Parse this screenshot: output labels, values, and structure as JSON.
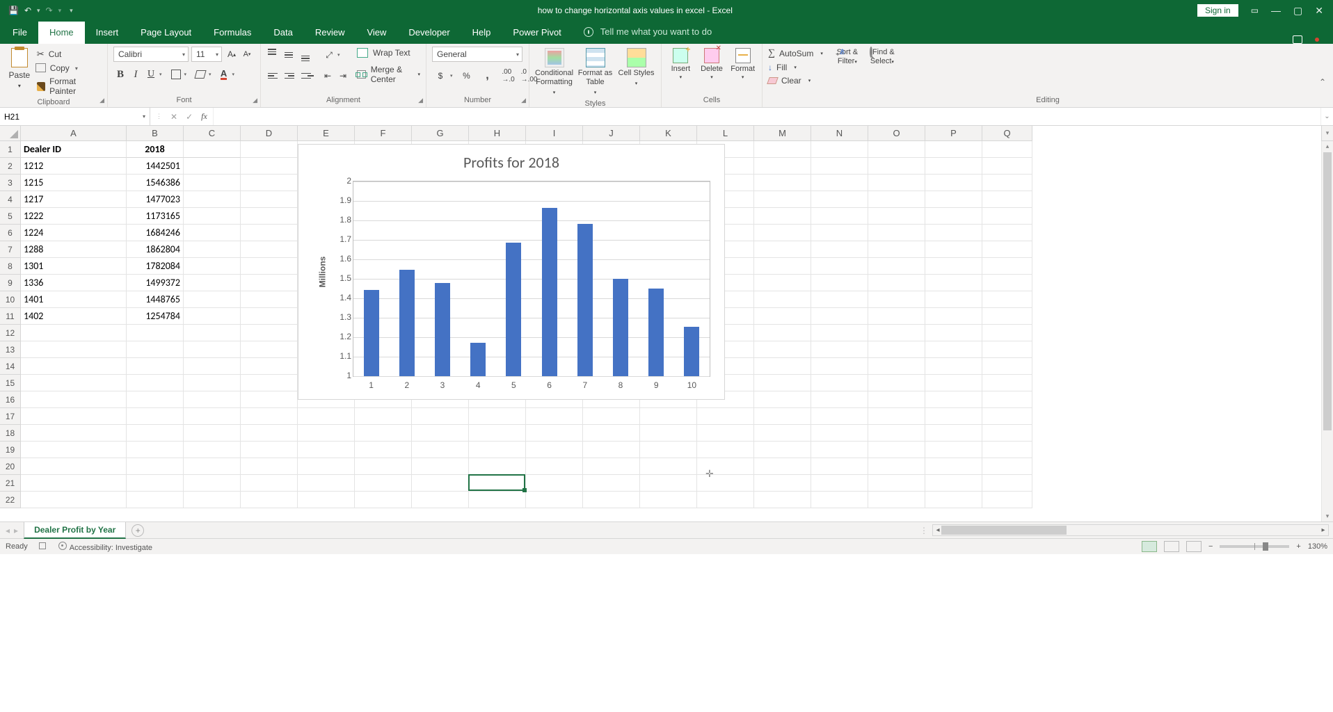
{
  "titlebar": {
    "title": "how to change horizontal axis values in excel  -  Excel",
    "signin": "Sign in"
  },
  "tabs": {
    "file": "File",
    "home": "Home",
    "insert": "Insert",
    "pagelayout": "Page Layout",
    "formulas": "Formulas",
    "data": "Data",
    "review": "Review",
    "view": "View",
    "developer": "Developer",
    "help": "Help",
    "powerpivot": "Power Pivot",
    "tellme": "Tell me what you want to do"
  },
  "ribbon": {
    "clipboard": {
      "paste": "Paste",
      "cut": "Cut",
      "copy": "Copy",
      "fmtpainter": "Format Painter",
      "label": "Clipboard"
    },
    "font": {
      "name": "Calibri",
      "size": "11",
      "label": "Font"
    },
    "alignment": {
      "wrap": "Wrap Text",
      "merge": "Merge & Center",
      "label": "Alignment"
    },
    "number": {
      "format": "General",
      "label": "Number"
    },
    "styles": {
      "cf": "Conditional Formatting",
      "tbl": "Format as Table",
      "cell": "Cell Styles",
      "label": "Styles"
    },
    "cells": {
      "ins": "Insert",
      "del": "Delete",
      "fmt": "Format",
      "label": "Cells"
    },
    "editing": {
      "autosum": "AutoSum",
      "fill": "Fill",
      "clear": "Clear",
      "sort": "Sort & Filter",
      "find": "Find & Select",
      "label": "Editing"
    }
  },
  "namebox": "H21",
  "columns": [
    "A",
    "B",
    "C",
    "D",
    "E",
    "F",
    "G",
    "H",
    "I",
    "J",
    "K",
    "L",
    "M",
    "N",
    "O",
    "P",
    "Q"
  ],
  "headers": {
    "dealer_id": "Dealer ID",
    "year": "2018"
  },
  "rows": [
    {
      "id": "1212",
      "val": "1442501"
    },
    {
      "id": "1215",
      "val": "1546386"
    },
    {
      "id": "1217",
      "val": "1477023"
    },
    {
      "id": "1222",
      "val": "1173165"
    },
    {
      "id": "1224",
      "val": "1684246"
    },
    {
      "id": "1288",
      "val": "1862804"
    },
    {
      "id": "1301",
      "val": "1782084"
    },
    {
      "id": "1336",
      "val": "1499372"
    },
    {
      "id": "1401",
      "val": "1448765"
    },
    {
      "id": "1402",
      "val": "1254784"
    }
  ],
  "chart_data": {
    "type": "bar",
    "title": "Profits for 2018",
    "categories": [
      "1",
      "2",
      "3",
      "4",
      "5",
      "6",
      "7",
      "8",
      "9",
      "10"
    ],
    "values": [
      1442501,
      1546386,
      1477023,
      1173165,
      1684246,
      1862804,
      1782084,
      1499372,
      1448765,
      1254784
    ],
    "ylabel": "Millions",
    "ylim": [
      1000000,
      2000000
    ],
    "yticks": [
      1,
      1.1,
      1.2,
      1.3,
      1.4,
      1.5,
      1.6,
      1.7,
      1.8,
      1.9,
      2
    ]
  },
  "sheet": {
    "name": "Dealer Profit by Year"
  },
  "status": {
    "ready": "Ready",
    "accessibility": "Accessibility: Investigate",
    "zoom": "130%"
  }
}
